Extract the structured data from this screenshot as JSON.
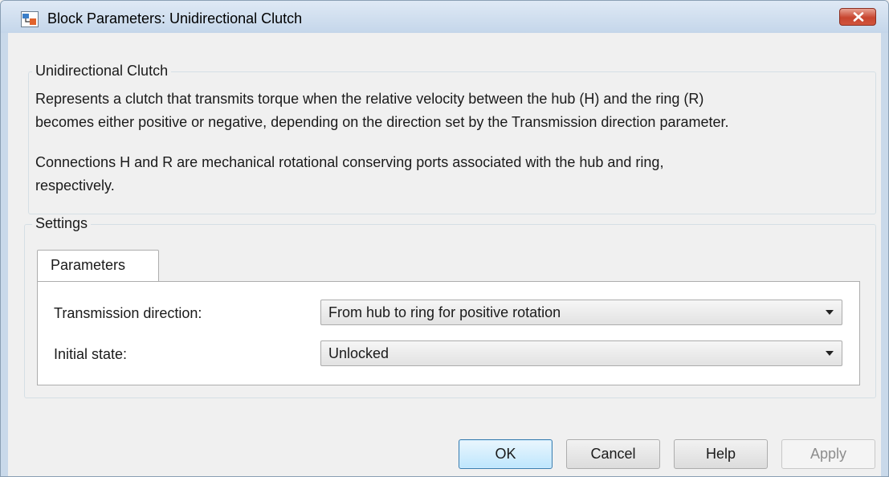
{
  "window": {
    "title": "Block Parameters: Unidirectional Clutch",
    "icons": {
      "app": "block-parameters-app-icon",
      "close": "close-icon"
    }
  },
  "description_group": {
    "title": "Unidirectional Clutch",
    "line1": "Represents a clutch that transmits torque when the relative velocity between the hub (H) and the ring (R)",
    "line2": "becomes either positive or negative, depending on the direction set by the Transmission direction parameter.",
    "line3": "Connections H and R are mechanical rotational conserving ports associated with the hub and ring,",
    "line4": "respectively."
  },
  "settings_group": {
    "title": "Settings",
    "tab_label": "Parameters",
    "parameters": {
      "transmission_direction": {
        "label": "Transmission direction:",
        "value": "From hub to ring for positive rotation"
      },
      "initial_state": {
        "label": "Initial state:",
        "value": "Unlocked"
      }
    }
  },
  "buttons": {
    "ok": "OK",
    "cancel": "Cancel",
    "help": "Help",
    "apply": "Apply"
  },
  "colors": {
    "title_bar": "#c9d9ea",
    "dialog_background": "#f0f0f0",
    "close_button": "#c7452f",
    "default_button_border": "#3c7fb1"
  }
}
